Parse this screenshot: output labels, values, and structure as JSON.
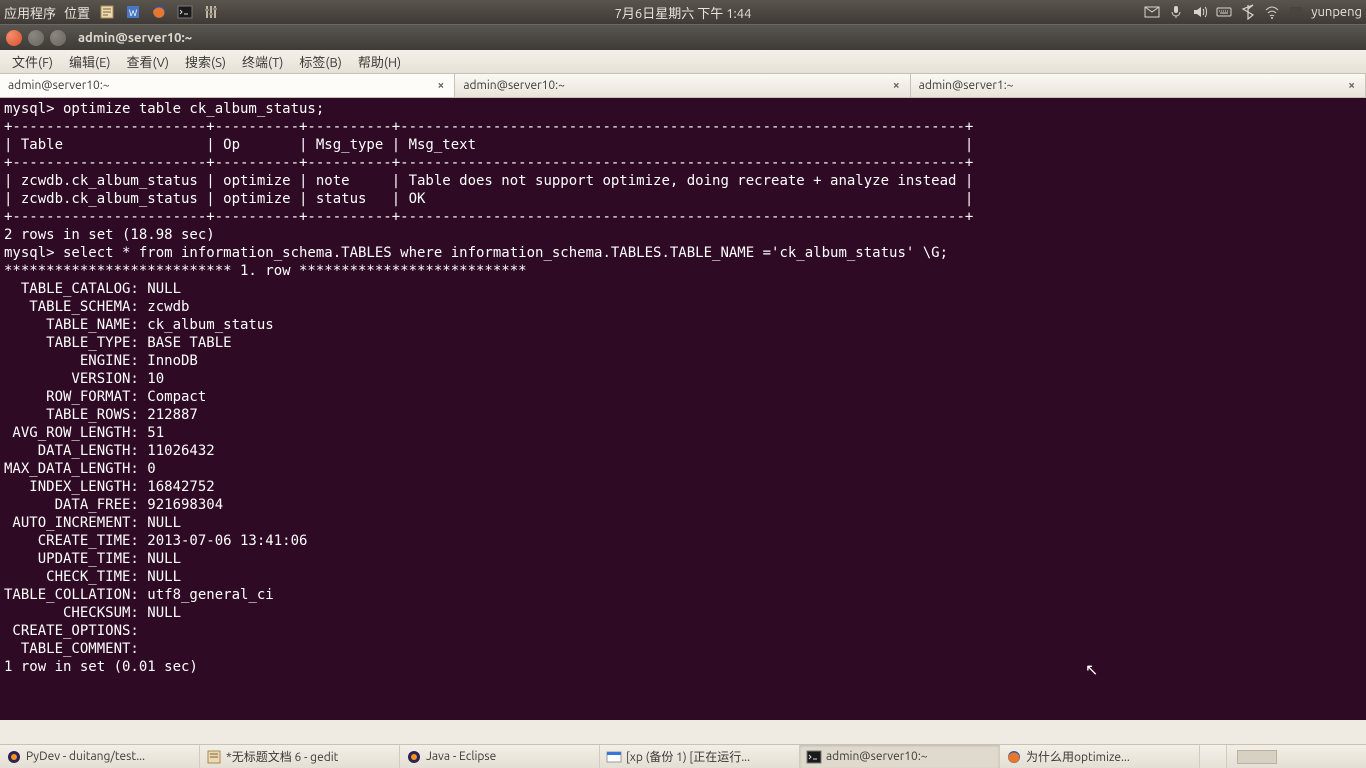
{
  "panel": {
    "apps": "应用程序",
    "places": "位置",
    "clock": "7月6日星期六 下午  1:44",
    "user": "yunpeng"
  },
  "window": {
    "title": "admin@server10:~"
  },
  "menu": {
    "file": "文件(F)",
    "edit": "编辑(E)",
    "view": "查看(V)",
    "search": "搜索(S)",
    "terminal": "终端(T)",
    "tabs": "标签(B)",
    "help": "帮助(H)"
  },
  "tabs": [
    {
      "label": "admin@server10:~"
    },
    {
      "label": "admin@server10:~"
    },
    {
      "label": "admin@server1:~"
    }
  ],
  "terminal": {
    "blank1": "",
    "l1": "mysql> optimize table ck_album_status;",
    "sep1": "+-----------------------+----------+----------+-------------------------------------------------------------------+",
    "hdr": "| Table                 | Op       | Msg_type | Msg_text                                                          |",
    "sep2": "+-----------------------+----------+----------+-------------------------------------------------------------------+",
    "r1": "| zcwdb.ck_album_status | optimize | note     | Table does not support optimize, doing recreate + analyze instead |",
    "r2": "| zcwdb.ck_album_status | optimize | status   | OK                                                                |",
    "sep3": "+-----------------------+----------+----------+-------------------------------------------------------------------+",
    "res1": "2 rows in set (18.98 sec)",
    "blank2": "",
    "l2": "mysql> select * from information_schema.TABLES where information_schema.TABLES.TABLE_NAME ='ck_album_status' \\G;",
    "rowh": "*************************** 1. row ***************************",
    "f01": "  TABLE_CATALOG: NULL",
    "f02": "   TABLE_SCHEMA: zcwdb",
    "f03": "     TABLE_NAME: ck_album_status",
    "f04": "     TABLE_TYPE: BASE TABLE",
    "f05": "         ENGINE: InnoDB",
    "f06": "        VERSION: 10",
    "f07": "     ROW_FORMAT: Compact",
    "f08": "     TABLE_ROWS: 212887",
    "f09": " AVG_ROW_LENGTH: 51",
    "f10": "    DATA_LENGTH: 11026432",
    "f11": "MAX_DATA_LENGTH: 0",
    "f12": "   INDEX_LENGTH: 16842752",
    "f13": "      DATA_FREE: 921698304",
    "f14": " AUTO_INCREMENT: NULL",
    "f15": "    CREATE_TIME: 2013-07-06 13:41:06",
    "f16": "    UPDATE_TIME: NULL",
    "f17": "     CHECK_TIME: NULL",
    "f18": "TABLE_COLLATION: utf8_general_ci",
    "f19": "       CHECKSUM: NULL",
    "f20": " CREATE_OPTIONS: ",
    "f21": "  TABLE_COMMENT: ",
    "res2": "1 row in set (0.01 sec)"
  },
  "taskbar": [
    {
      "label": "PyDev - duitang/test..."
    },
    {
      "label": "*无标题文档 6 - gedit"
    },
    {
      "label": "Java - Eclipse"
    },
    {
      "label": "[xp (备份 1) [正在运行..."
    },
    {
      "label": "admin@server10:~"
    },
    {
      "label": "为什么用optimize..."
    }
  ]
}
